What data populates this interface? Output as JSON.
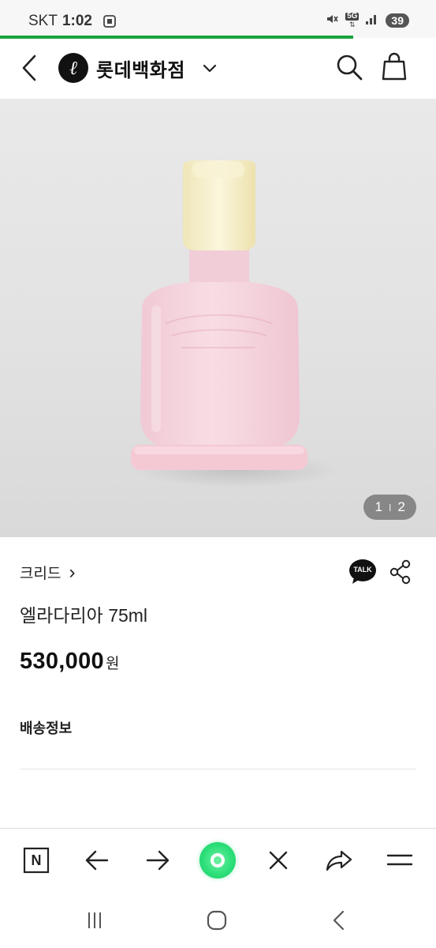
{
  "status_bar": {
    "carrier": "SKT",
    "time": "1:02",
    "network": "5G",
    "battery": "39"
  },
  "page_load_progress": 0.81,
  "header": {
    "brand_name": "롯데백화점",
    "logo_letter": "ℓ"
  },
  "gallery": {
    "current": "1",
    "separator": "I",
    "total": "2"
  },
  "product": {
    "brand": "크리드",
    "brand_chevron": "›",
    "name": "엘라다리아 75ml",
    "price": "530,000",
    "currency": "원",
    "shipping_label": "배송정보",
    "talk_label": "TALK"
  },
  "browser_toolbar": {
    "n_label": "N"
  },
  "colors": {
    "progress": "#19a33f",
    "accent_green": "#2ee07a",
    "bottle_pink": "#f3d3dc",
    "cap_cream": "#f3ecc4"
  }
}
